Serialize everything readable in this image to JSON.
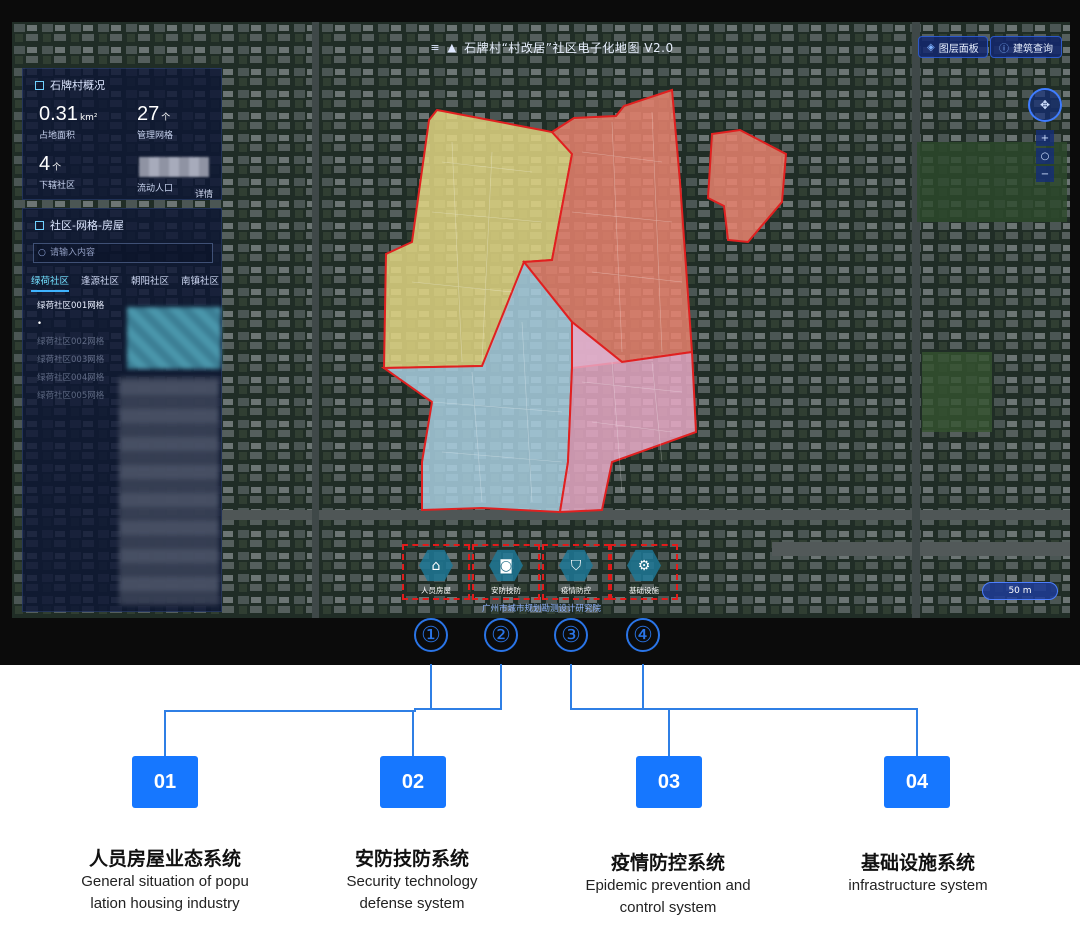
{
  "map": {
    "title": "石牌村“村改居”社区电子化地图 V2.0",
    "layer_button": "图层面板",
    "building_button": "建筑查询",
    "scale": "50 m",
    "credit": "广州市城市规划勘测设计研究院",
    "region_colors": {
      "yellow": "#e2d682",
      "red": "#e9836f",
      "blue": "#a9cfe0",
      "pink": "#e7a9c6",
      "border": "#e02020"
    }
  },
  "overview": {
    "title": "石牌村概况",
    "area": {
      "value": "0.31",
      "unit": "km²",
      "label": "占地面积"
    },
    "grids": {
      "value": "27",
      "unit": "个",
      "label": "管理网格"
    },
    "communities": {
      "value": "4",
      "unit": "个",
      "label": "下辖社区"
    },
    "floating": {
      "label": "流动人口",
      "link": "详情"
    }
  },
  "community_panel": {
    "title": "社区-网格-房屋",
    "search_placeholder": "请输入内容",
    "tabs": [
      "绿荷社区",
      "逢源社区",
      "朝阳社区",
      "南镇社区"
    ],
    "grids": [
      "绿荷社区001网格",
      "绿荷社区002网格",
      "绿荷社区003网格",
      "绿荷社区004网格",
      "绿荷社区005网格"
    ]
  },
  "toolbar": [
    {
      "label": "人员房屋",
      "icon": "house-icon"
    },
    {
      "label": "安防技防",
      "icon": "camera-icon"
    },
    {
      "label": "疫情防控",
      "icon": "shield-icon"
    },
    {
      "label": "基础设施",
      "icon": "gear-icon"
    }
  ],
  "circled_numbers": [
    "①",
    "②",
    "③",
    "④"
  ],
  "systems": [
    {
      "num": "01",
      "zh": "人员房屋业态系统",
      "en": [
        "General situation of popu",
        "lation housing industry"
      ]
    },
    {
      "num": "02",
      "zh": "安防技防系统",
      "en": [
        "Security technology",
        "defense system"
      ]
    },
    {
      "num": "03",
      "zh": "疫情防控系统",
      "en": [
        "Epidemic prevention and",
        "control system"
      ]
    },
    {
      "num": "04",
      "zh": "基础设施系统",
      "en": [
        "infrastructure system"
      ]
    }
  ],
  "accent": "#1677ff"
}
